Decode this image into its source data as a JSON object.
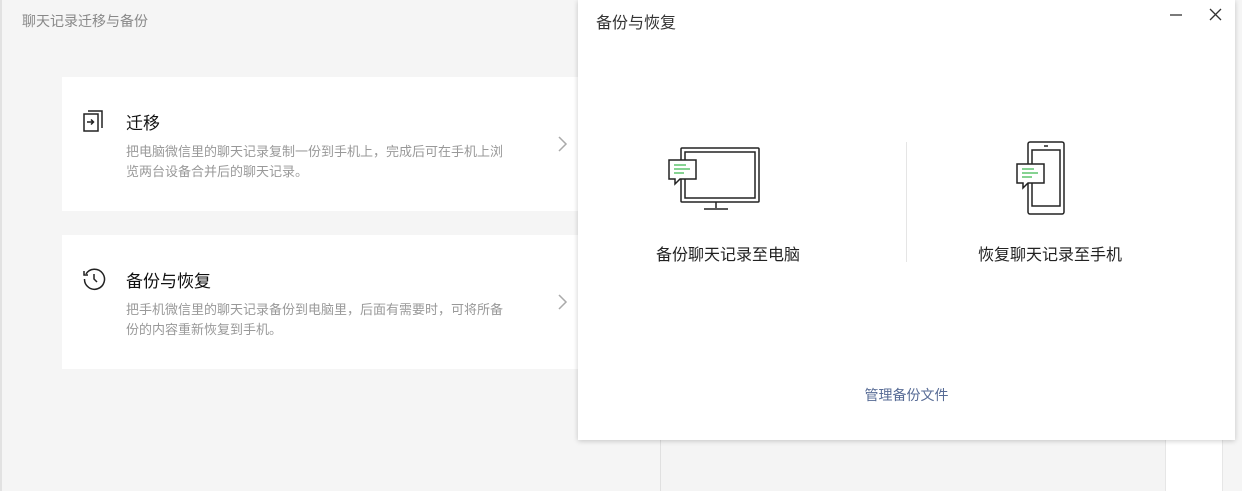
{
  "main_window": {
    "title": "聊天记录迁移与备份",
    "cards": [
      {
        "title": "迁移",
        "description": "把电脑微信里的聊天记录复制一份到手机上，完成后可在手机上浏览两台设备合并后的聊天记录。",
        "icon": "migrate-icon"
      },
      {
        "title": "备份与恢复",
        "description": "把手机微信里的聊天记录备份到电脑里，后面有需要时，可将所备份的内容重新恢复到手机。",
        "icon": "history-icon"
      }
    ]
  },
  "dialog": {
    "title": "备份与恢复",
    "options": [
      {
        "label": "备份聊天记录至电脑",
        "icon": "monitor-chat-icon"
      },
      {
        "label": "恢复聊天记录至手机",
        "icon": "phone-chat-icon"
      }
    ],
    "manage_link": "管理备份文件"
  },
  "colors": {
    "accent_green": "#3fb950",
    "link": "#576b95"
  }
}
